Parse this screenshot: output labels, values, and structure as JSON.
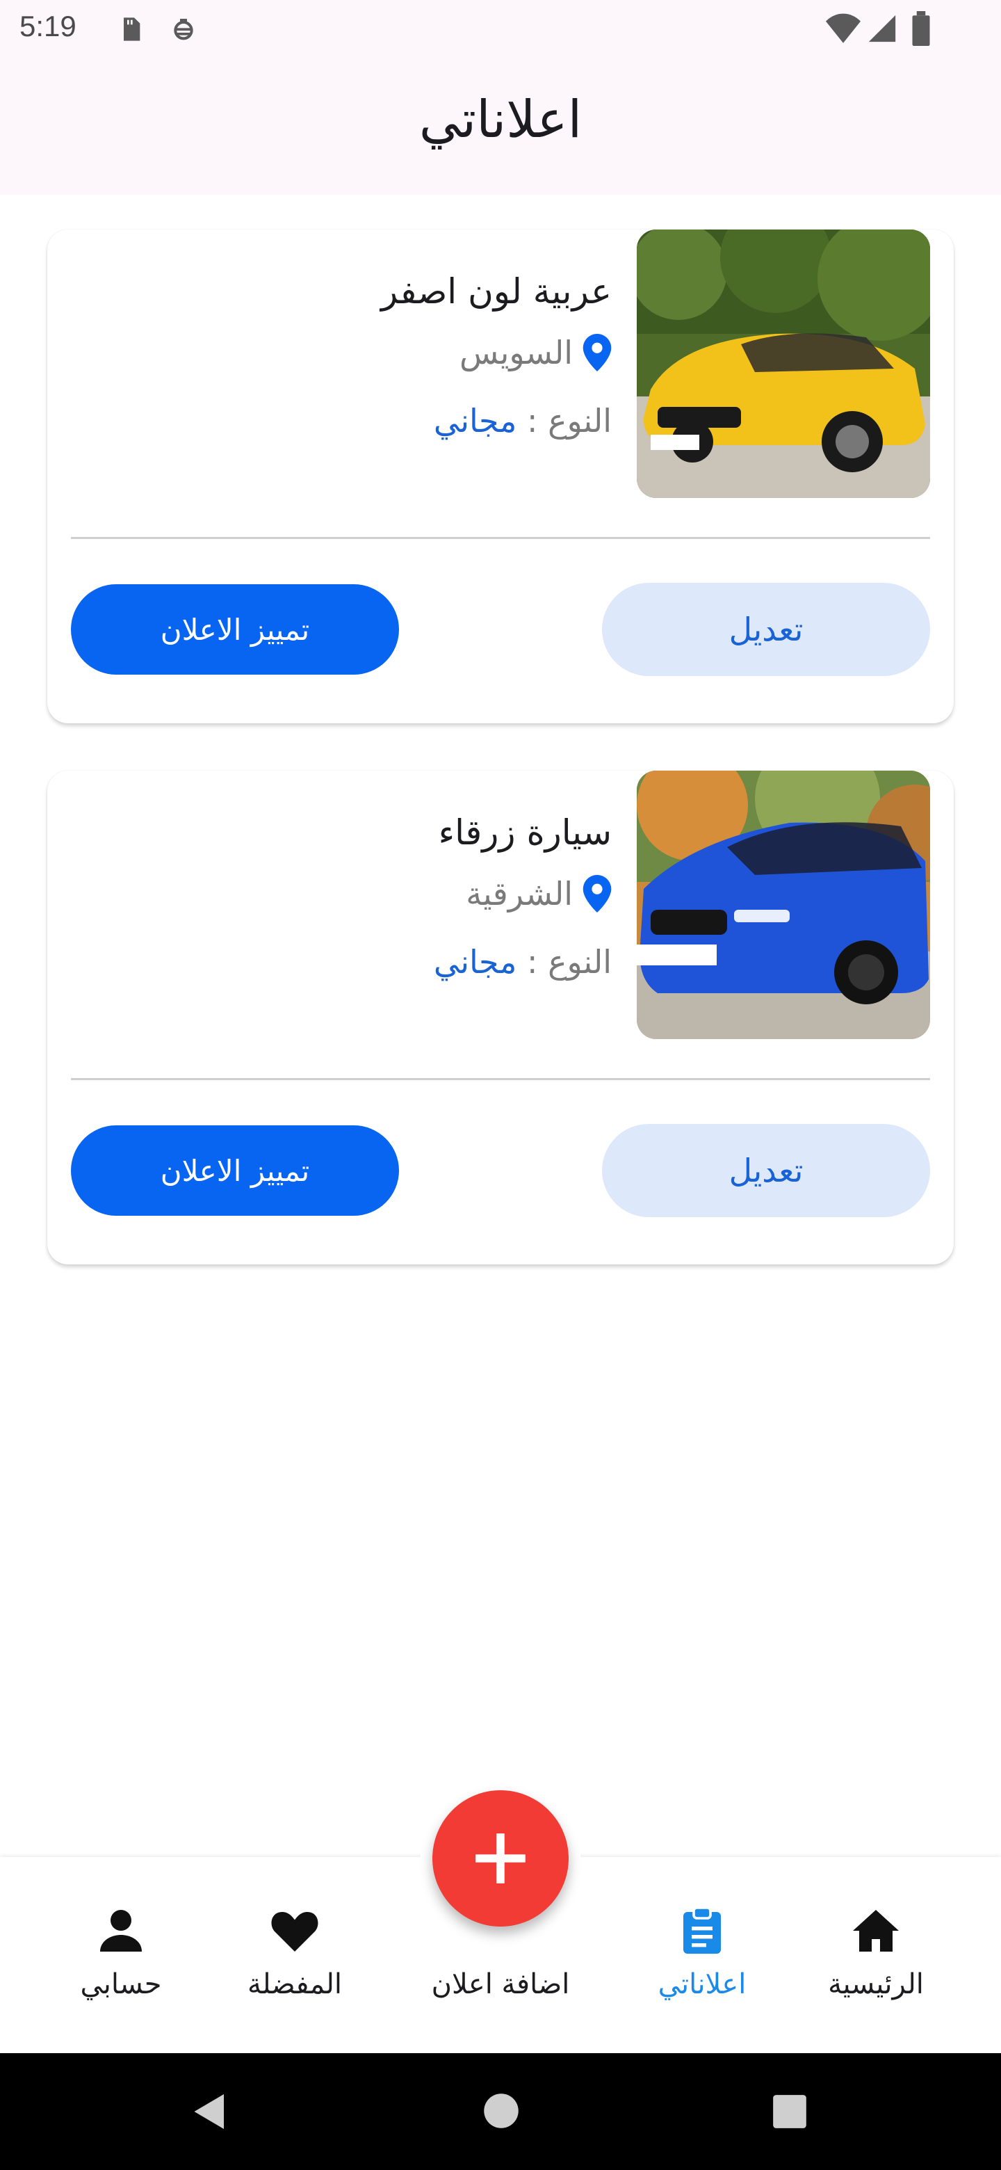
{
  "status_bar": {
    "time": "5:19",
    "icons": [
      "sd-card-icon",
      "bug-icon",
      "wifi-icon",
      "signal-icon",
      "battery-icon"
    ]
  },
  "app_bar": {
    "title": "اعلاناتي"
  },
  "listings": [
    {
      "title": "عربية لون اصفر",
      "location": "السويس",
      "type_label": "النوع :",
      "type_value": "مجاني",
      "edit_label": "تعديل",
      "feature_label": "تمييز الاعلان",
      "car_color": "#f2c21b"
    },
    {
      "title": "سيارة زرقاء",
      "location": "الشرقية",
      "type_label": "النوع :",
      "type_value": "مجاني",
      "edit_label": "تعديل",
      "feature_label": "تمييز الاعلان",
      "car_color": "#1f54d9"
    }
  ],
  "bottom_nav": {
    "items": [
      {
        "label": "حسابي",
        "icon": "person-icon"
      },
      {
        "label": "المفضلة",
        "icon": "heart-icon"
      },
      {
        "label": "اضافة اعلان",
        "icon": "add-icon"
      },
      {
        "label": "اعلاناتي",
        "icon": "clipboard-icon",
        "active": true
      },
      {
        "label": "الرئيسية",
        "icon": "home-icon"
      }
    ]
  },
  "colors": {
    "primary": "#0765f1",
    "primary_light": "#dde8fb",
    "accent_text": "#1a63d6",
    "fab": "#f23b35",
    "active_nav": "#1a8ae8"
  }
}
